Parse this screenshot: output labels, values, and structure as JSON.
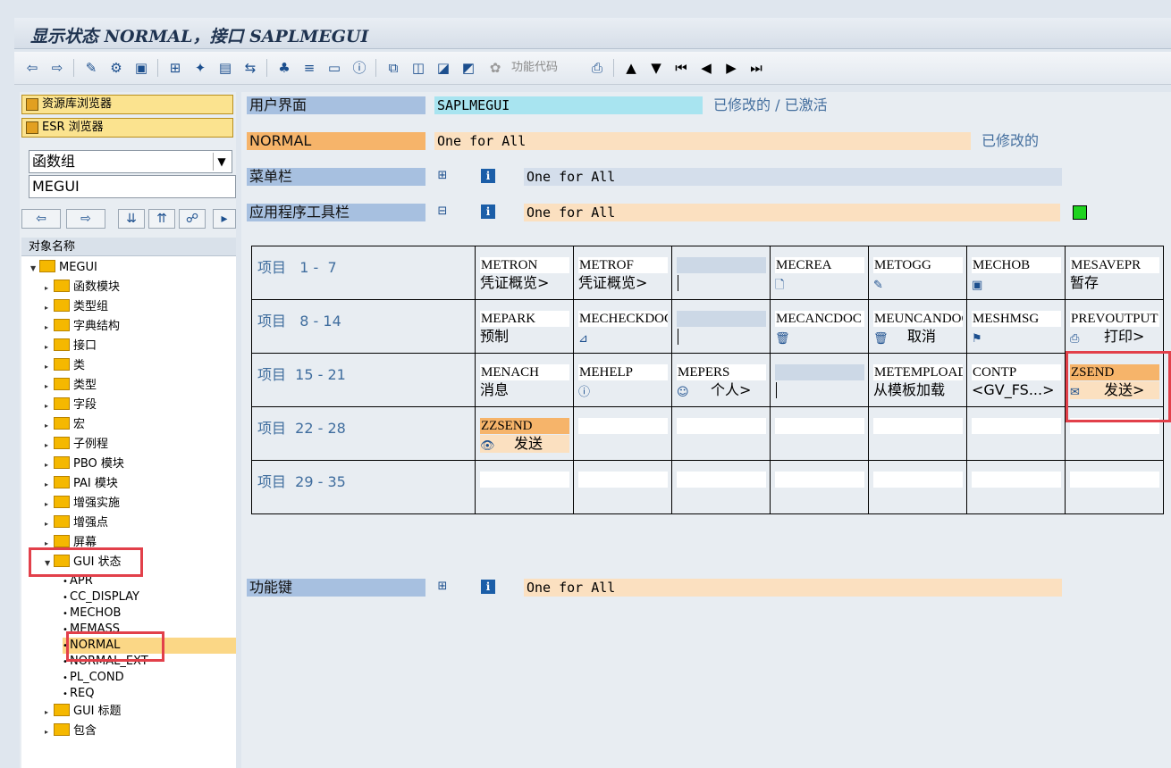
{
  "window": {
    "title": "显示状态 NORMAL，接口 SAPLMEGUI"
  },
  "toolbar": {
    "function_code_label": "功能代码"
  },
  "left": {
    "repo_browser": "资源库浏览器",
    "esr_browser": "ESR 浏览器",
    "object_type": "函数组",
    "object_name": "MEGUI",
    "tree_header": "对象名称",
    "tree": {
      "root": "MEGUI",
      "folders": [
        "函数模块",
        "类型组",
        "字典结构",
        "接口",
        "类",
        "类型",
        "字段",
        "宏",
        "子例程",
        "PBO 模块",
        "PAI 模块",
        "增强实施",
        "增强点",
        "屏幕"
      ],
      "gui_status": "GUI 状态",
      "statuses": [
        "APR",
        "CC_DISPLAY",
        "MECHOB",
        "MEMASS",
        "NORMAL",
        "NORMAL_EXT",
        "PL_COND",
        "REQ"
      ],
      "gui_title": "GUI 标题",
      "includes": "包含"
    }
  },
  "main": {
    "ui_label": "用户界面",
    "ui_value": "SAPLMEGUI",
    "ui_status": "已修改的 / 已激活",
    "status_name": "NORMAL",
    "status_text": "One for All",
    "status_state": "已修改的",
    "menubar_label": "菜单栏",
    "menubar_text": "One for All",
    "apptoolbar_label": "应用程序工具栏",
    "apptoolbar_text": "One for All",
    "fkey_label": "功能键",
    "fkey_text": "One for All",
    "rows": [
      {
        "label": "项目   1 -  7",
        "items": [
          {
            "code": "METRON",
            "text": "凭证概览>"
          },
          {
            "code": "METROF",
            "text": "凭证概览>"
          },
          {
            "code": "",
            "text": ""
          },
          {
            "code": "MECREA",
            "text": "",
            "icon": "document-icon"
          },
          {
            "code": "METOGG",
            "text": "",
            "icon": "toggle-icon"
          },
          {
            "code": "MECHOB",
            "text": "",
            "icon": "change-icon"
          },
          {
            "code": "MESAVEPR",
            "text": "暂存"
          }
        ]
      },
      {
        "label": "项目   8 - 14",
        "items": [
          {
            "code": "MEPARK",
            "text": "预制"
          },
          {
            "code": "MECHECKDOC",
            "text": "",
            "icon": "check-icon"
          },
          {
            "code": "",
            "text": ""
          },
          {
            "code": "MECANCDOC",
            "text": "",
            "icon": "trash-icon"
          },
          {
            "code": "MEUNCANDOC",
            "text": "取消",
            "icon": "trash-icon"
          },
          {
            "code": "MESHMSG",
            "text": "",
            "icon": "message-icon"
          },
          {
            "code": "PREVOUTPUT",
            "text": "打印>",
            "icon": "print-icon"
          }
        ]
      },
      {
        "label": "项目  15 - 21",
        "items": [
          {
            "code": "MENACH",
            "text": "消息"
          },
          {
            "code": "MEHELP",
            "text": "",
            "icon": "info-icon"
          },
          {
            "code": "MEPERS",
            "text": "个人>",
            "icon": "person-icon"
          },
          {
            "code": "",
            "text": ""
          },
          {
            "code": "METEMPLOAD",
            "text": "从模板加载"
          },
          {
            "code": "CONTP",
            "text": "<GV_FS...>"
          },
          {
            "code": "ZSEND",
            "text": "发送>",
            "icon": "send-icon"
          }
        ]
      },
      {
        "label": "项目  22 - 28",
        "items": [
          {
            "code": "ZZSEND",
            "text": "发送",
            "icon": "eye-icon"
          },
          {
            "code": "",
            "text": ""
          },
          {
            "code": "",
            "text": ""
          },
          {
            "code": "",
            "text": ""
          },
          {
            "code": "",
            "text": ""
          },
          {
            "code": "",
            "text": ""
          },
          {
            "code": "",
            "text": ""
          }
        ]
      },
      {
        "label": "项目  29 - 35",
        "items": [
          {
            "code": "",
            "text": ""
          },
          {
            "code": "",
            "text": ""
          },
          {
            "code": "",
            "text": ""
          },
          {
            "code": "",
            "text": ""
          },
          {
            "code": "",
            "text": ""
          },
          {
            "code": "",
            "text": ""
          },
          {
            "code": "",
            "text": ""
          }
        ]
      }
    ]
  }
}
